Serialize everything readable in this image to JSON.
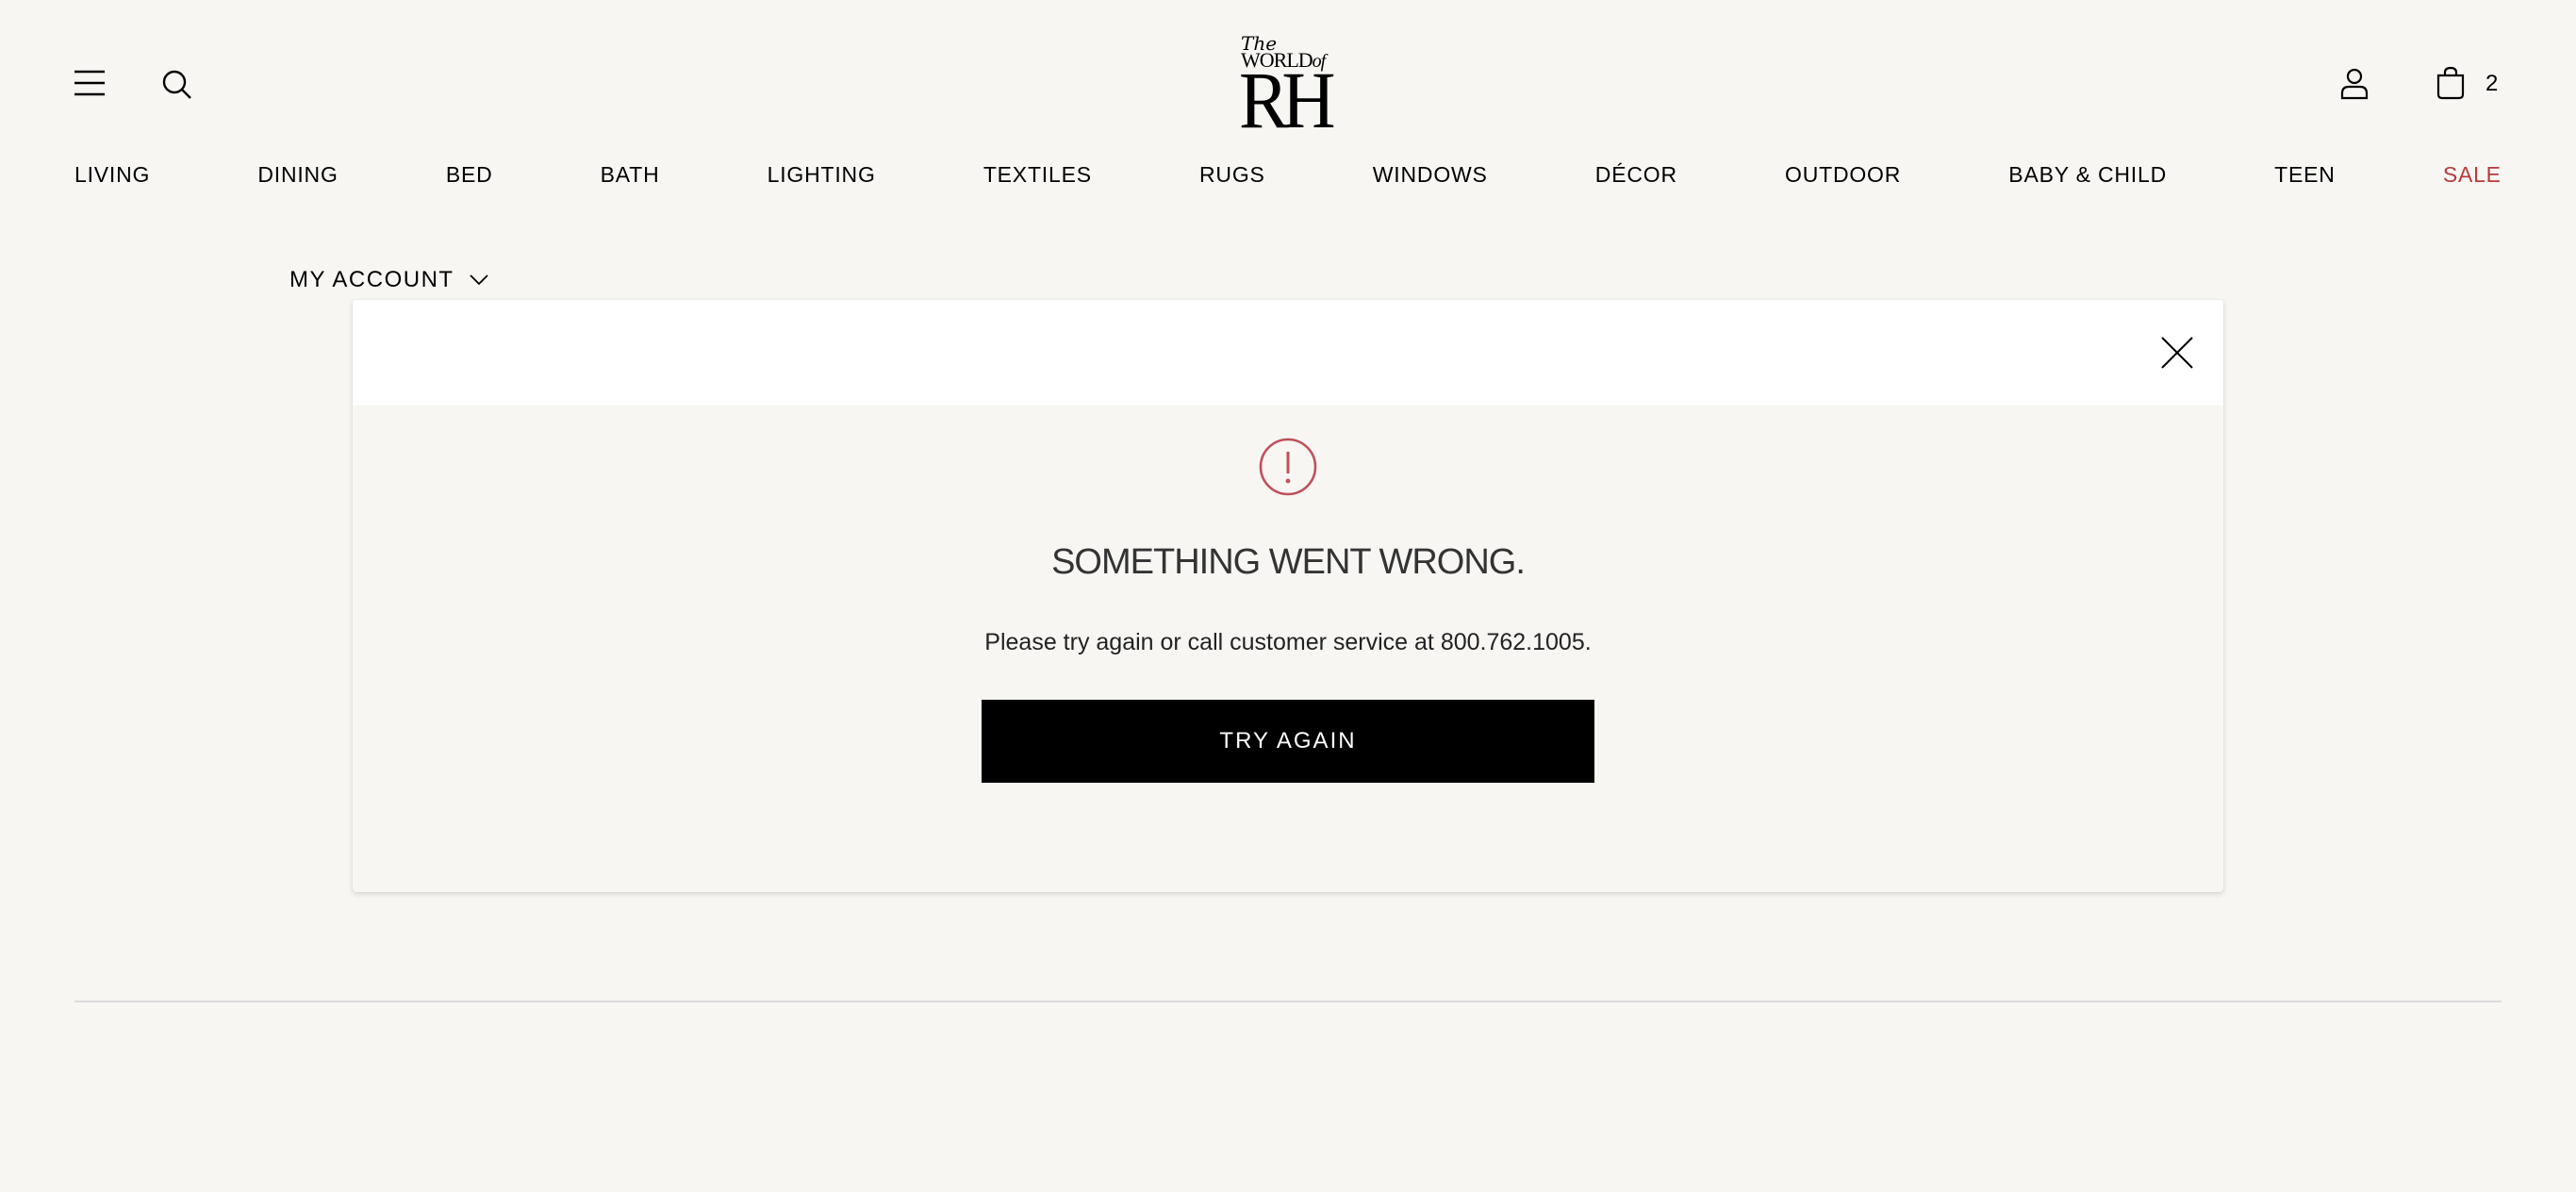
{
  "header": {
    "logo": {
      "line1": "The",
      "line2": "WORLD",
      "line2_suffix": "of",
      "mark": "RH"
    },
    "icons": {
      "menu": "hamburger-menu-icon",
      "search": "search-icon",
      "account": "user-icon",
      "cart": "shopping-bag-icon"
    },
    "cart_count": "2"
  },
  "nav": {
    "items": [
      "LIVING",
      "DINING",
      "BED",
      "BATH",
      "LIGHTING",
      "TEXTILES",
      "RUGS",
      "WINDOWS",
      "DÉCOR",
      "OUTDOOR",
      "BABY & CHILD",
      "TEEN",
      "SALE"
    ],
    "sale_color": "#b83a3a"
  },
  "account_menu": {
    "label": "MY ACCOUNT"
  },
  "error_modal": {
    "title": "SOMETHING WENT WRONG.",
    "message": "Please try again or call customer service at 800.762.1005.",
    "button_label": "TRY AGAIN",
    "icon": "alert-circle-icon",
    "accent_color": "#c0505a"
  },
  "colors": {
    "background": "#f7f6f3",
    "modal_header": "#ffffff",
    "button": "#000000"
  }
}
